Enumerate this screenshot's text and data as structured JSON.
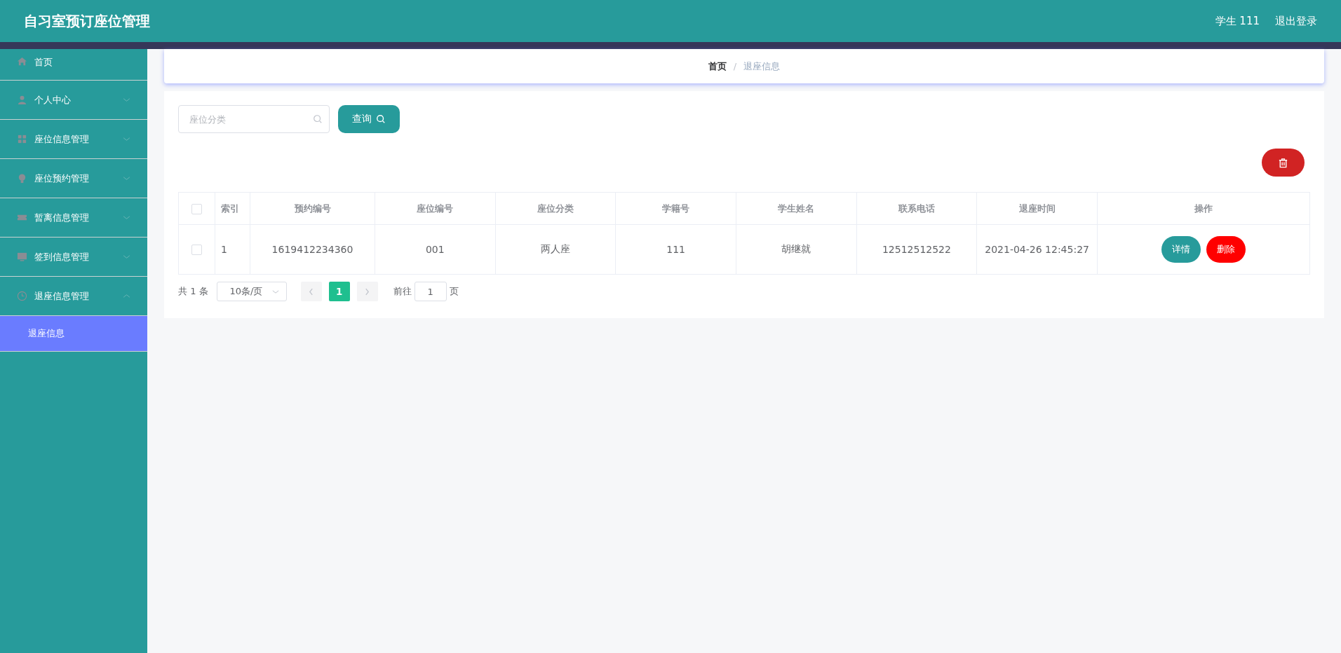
{
  "header": {
    "title": "自习室预订座位管理",
    "user": "学生 111",
    "logout": "退出登录"
  },
  "sidebar": {
    "items": [
      {
        "kind": "home",
        "label": "首页"
      },
      {
        "kind": "person",
        "label": "个人中心",
        "expanded": false
      },
      {
        "kind": "grid",
        "label": "座位信息管理",
        "expanded": false
      },
      {
        "kind": "bulb",
        "label": "座位预约管理",
        "expanded": false
      },
      {
        "kind": "ticket",
        "label": "暂离信息管理",
        "expanded": false
      },
      {
        "kind": "monitor",
        "label": "签到信息管理",
        "expanded": false
      },
      {
        "kind": "clock",
        "label": "退座信息管理",
        "expanded": true,
        "children": [
          {
            "label": "退座信息",
            "selected": true
          }
        ]
      }
    ]
  },
  "breadcrumb": [
    "首页",
    "退座信息"
  ],
  "breadcrumb_separator": "/",
  "search": {
    "placeholder": "座位分类",
    "button": "查询"
  },
  "table": {
    "select_all_checked": false,
    "columns": [
      "索引",
      "预约编号",
      "座位编号",
      "座位分类",
      "学籍号",
      "学生姓名",
      "联系电话",
      "退座时间",
      "操作"
    ],
    "rows": [
      {
        "checked": false,
        "cells": [
          "1",
          "1619412234360",
          "001",
          "两人座",
          "111",
          "胡继就",
          "12512512522",
          "2021-04-26 12:45:27"
        ],
        "actions": [
          "详情",
          "删除"
        ]
      }
    ]
  },
  "pagination": {
    "total": "共 1 条",
    "page_size": "10条/页",
    "pages": [
      {
        "label": "1",
        "selected": true
      }
    ],
    "goto_label": "前往",
    "goto_value": "1",
    "goto_suffix": "页"
  }
}
